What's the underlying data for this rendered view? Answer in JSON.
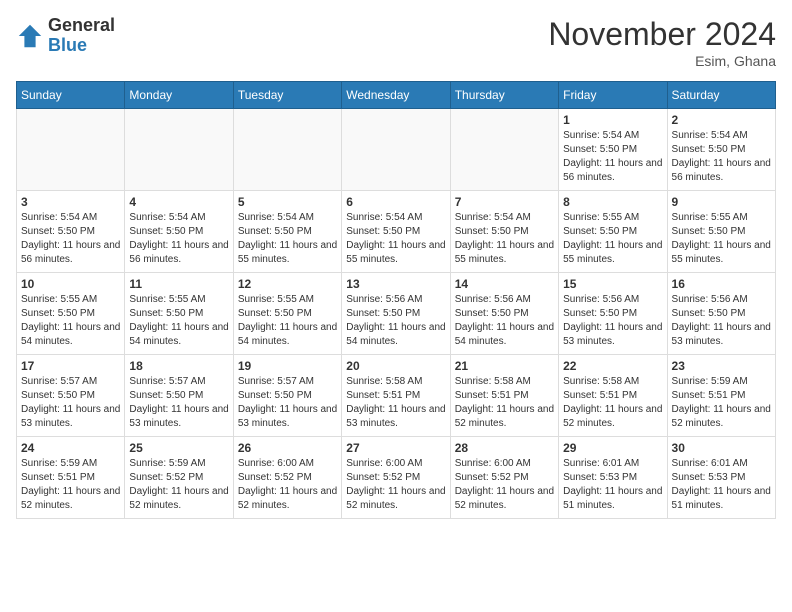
{
  "header": {
    "logo_general": "General",
    "logo_blue": "Blue",
    "month_year": "November 2024",
    "location": "Esim, Ghana"
  },
  "days_of_week": [
    "Sunday",
    "Monday",
    "Tuesday",
    "Wednesday",
    "Thursday",
    "Friday",
    "Saturday"
  ],
  "weeks": [
    [
      {
        "day": "",
        "info": ""
      },
      {
        "day": "",
        "info": ""
      },
      {
        "day": "",
        "info": ""
      },
      {
        "day": "",
        "info": ""
      },
      {
        "day": "",
        "info": ""
      },
      {
        "day": "1",
        "info": "Sunrise: 5:54 AM\nSunset: 5:50 PM\nDaylight: 11 hours and 56 minutes."
      },
      {
        "day": "2",
        "info": "Sunrise: 5:54 AM\nSunset: 5:50 PM\nDaylight: 11 hours and 56 minutes."
      }
    ],
    [
      {
        "day": "3",
        "info": "Sunrise: 5:54 AM\nSunset: 5:50 PM\nDaylight: 11 hours and 56 minutes."
      },
      {
        "day": "4",
        "info": "Sunrise: 5:54 AM\nSunset: 5:50 PM\nDaylight: 11 hours and 56 minutes."
      },
      {
        "day": "5",
        "info": "Sunrise: 5:54 AM\nSunset: 5:50 PM\nDaylight: 11 hours and 55 minutes."
      },
      {
        "day": "6",
        "info": "Sunrise: 5:54 AM\nSunset: 5:50 PM\nDaylight: 11 hours and 55 minutes."
      },
      {
        "day": "7",
        "info": "Sunrise: 5:54 AM\nSunset: 5:50 PM\nDaylight: 11 hours and 55 minutes."
      },
      {
        "day": "8",
        "info": "Sunrise: 5:55 AM\nSunset: 5:50 PM\nDaylight: 11 hours and 55 minutes."
      },
      {
        "day": "9",
        "info": "Sunrise: 5:55 AM\nSunset: 5:50 PM\nDaylight: 11 hours and 55 minutes."
      }
    ],
    [
      {
        "day": "10",
        "info": "Sunrise: 5:55 AM\nSunset: 5:50 PM\nDaylight: 11 hours and 54 minutes."
      },
      {
        "day": "11",
        "info": "Sunrise: 5:55 AM\nSunset: 5:50 PM\nDaylight: 11 hours and 54 minutes."
      },
      {
        "day": "12",
        "info": "Sunrise: 5:55 AM\nSunset: 5:50 PM\nDaylight: 11 hours and 54 minutes."
      },
      {
        "day": "13",
        "info": "Sunrise: 5:56 AM\nSunset: 5:50 PM\nDaylight: 11 hours and 54 minutes."
      },
      {
        "day": "14",
        "info": "Sunrise: 5:56 AM\nSunset: 5:50 PM\nDaylight: 11 hours and 54 minutes."
      },
      {
        "day": "15",
        "info": "Sunrise: 5:56 AM\nSunset: 5:50 PM\nDaylight: 11 hours and 53 minutes."
      },
      {
        "day": "16",
        "info": "Sunrise: 5:56 AM\nSunset: 5:50 PM\nDaylight: 11 hours and 53 minutes."
      }
    ],
    [
      {
        "day": "17",
        "info": "Sunrise: 5:57 AM\nSunset: 5:50 PM\nDaylight: 11 hours and 53 minutes."
      },
      {
        "day": "18",
        "info": "Sunrise: 5:57 AM\nSunset: 5:50 PM\nDaylight: 11 hours and 53 minutes."
      },
      {
        "day": "19",
        "info": "Sunrise: 5:57 AM\nSunset: 5:50 PM\nDaylight: 11 hours and 53 minutes."
      },
      {
        "day": "20",
        "info": "Sunrise: 5:58 AM\nSunset: 5:51 PM\nDaylight: 11 hours and 53 minutes."
      },
      {
        "day": "21",
        "info": "Sunrise: 5:58 AM\nSunset: 5:51 PM\nDaylight: 11 hours and 52 minutes."
      },
      {
        "day": "22",
        "info": "Sunrise: 5:58 AM\nSunset: 5:51 PM\nDaylight: 11 hours and 52 minutes."
      },
      {
        "day": "23",
        "info": "Sunrise: 5:59 AM\nSunset: 5:51 PM\nDaylight: 11 hours and 52 minutes."
      }
    ],
    [
      {
        "day": "24",
        "info": "Sunrise: 5:59 AM\nSunset: 5:51 PM\nDaylight: 11 hours and 52 minutes."
      },
      {
        "day": "25",
        "info": "Sunrise: 5:59 AM\nSunset: 5:52 PM\nDaylight: 11 hours and 52 minutes."
      },
      {
        "day": "26",
        "info": "Sunrise: 6:00 AM\nSunset: 5:52 PM\nDaylight: 11 hours and 52 minutes."
      },
      {
        "day": "27",
        "info": "Sunrise: 6:00 AM\nSunset: 5:52 PM\nDaylight: 11 hours and 52 minutes."
      },
      {
        "day": "28",
        "info": "Sunrise: 6:00 AM\nSunset: 5:52 PM\nDaylight: 11 hours and 52 minutes."
      },
      {
        "day": "29",
        "info": "Sunrise: 6:01 AM\nSunset: 5:53 PM\nDaylight: 11 hours and 51 minutes."
      },
      {
        "day": "30",
        "info": "Sunrise: 6:01 AM\nSunset: 5:53 PM\nDaylight: 11 hours and 51 minutes."
      }
    ]
  ]
}
